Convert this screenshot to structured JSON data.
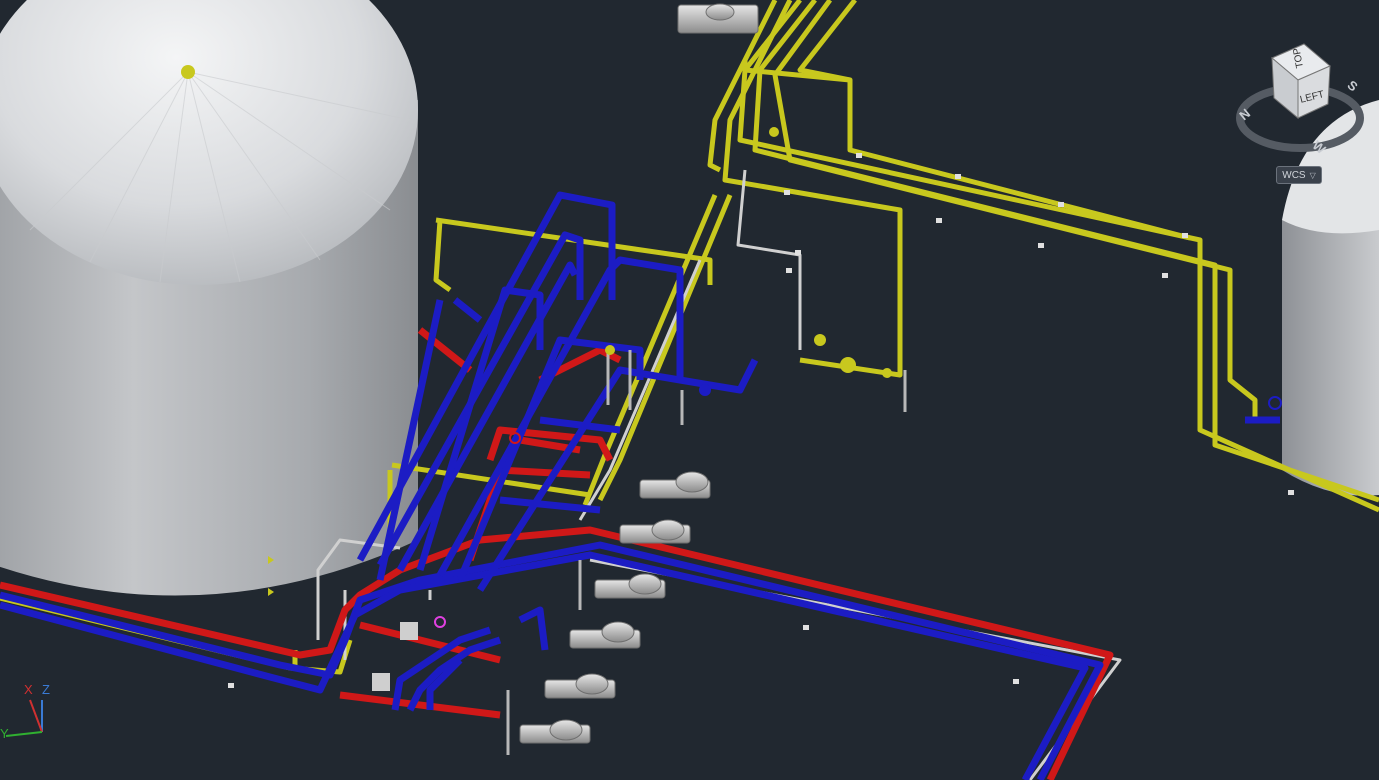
{
  "viewcube": {
    "top_label": "TOP",
    "left_label": "LEFT",
    "compass": {
      "north": "N",
      "south": "S",
      "west": "W"
    }
  },
  "wcs": {
    "label": "WCS",
    "caret_icon": "chevron-down-icon"
  },
  "ucs": {
    "x_label": "X",
    "y_label": "Y",
    "z_label": "Z"
  },
  "colors": {
    "background": "#212830",
    "pipe_yellow": "#c8c81e",
    "pipe_blue": "#1c1cc4",
    "pipe_red": "#d01818",
    "pipe_white": "#d8d8d8",
    "tank_gray": "#a4a8ad"
  }
}
